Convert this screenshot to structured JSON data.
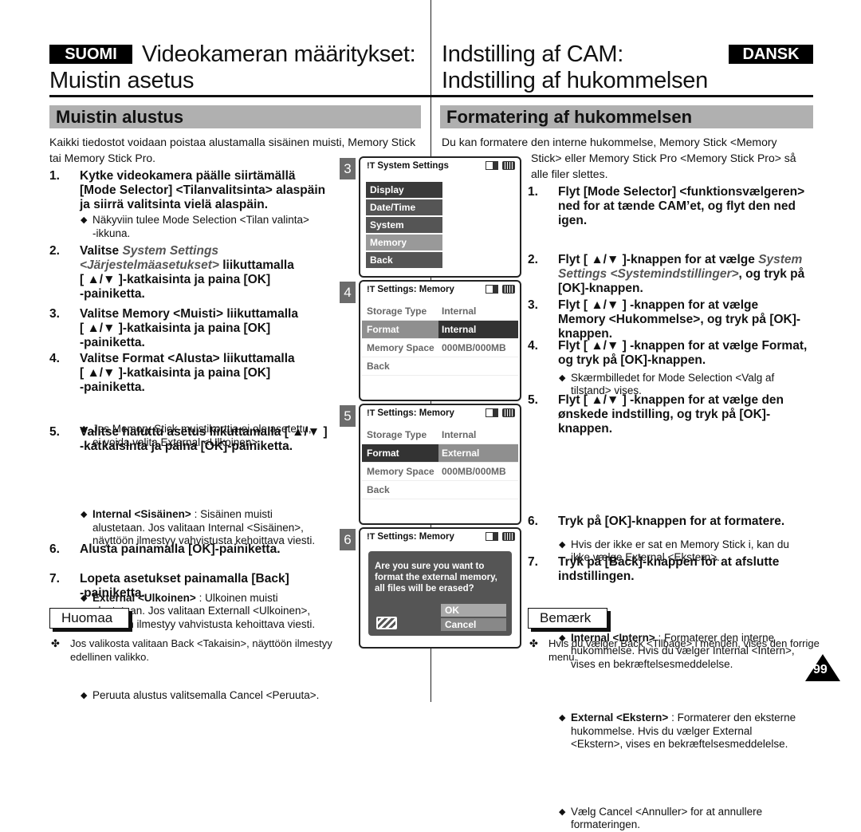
{
  "left": {
    "lang_badge": "SUOMI",
    "title_line1": "Videokameran määritykset:",
    "title_line2": "Muistin asetus",
    "section": "Muistin alustus",
    "intro": "Kaikki tiedostot voidaan poistaa alustamalla sisäinen muisti, Memory Stick tai Memory Stick Pro.",
    "steps": [
      {
        "num": "1.",
        "lines": [
          "Kytke videokamera päälle siirtämällä",
          "[Mode Selector] <Tilanvalitsinta> alaspäin",
          "ja siirrä valitsinta vielä alaspäin."
        ]
      },
      {
        "num": "2.",
        "pre": "Valitse ",
        "italic1": "System Settings",
        "italic2": "<Järjestelmäasetukset>",
        "post": " liikuttamalla",
        "lines": [
          "[ ▲/▼ ]-katkaisinta ja paina [OK]",
          "-painiketta."
        ]
      },
      {
        "num": "3.",
        "lines": [
          "Valitse Memory <Muisti> liikuttamalla",
          "[ ▲/▼ ]-katkaisinta ja paina [OK]",
          "-painiketta."
        ]
      },
      {
        "num": "4.",
        "lines": [
          "Valitse Format <Alusta> liikuttamalla",
          "[ ▲/▼ ]-katkaisinta ja paina [OK]",
          "-painiketta."
        ]
      },
      {
        "num": "5.",
        "lines": [
          "Valitse haluttu asetus liikuttamalla [ ▲/▼ ]",
          "-katkaisinta ja paina [OK]-painiketta."
        ]
      },
      {
        "num": "6.",
        "lines": [
          "Alusta painamalla [OK]-painiketta."
        ]
      },
      {
        "num": "7.",
        "lines": [
          "Lopeta asetukset painamalla [Back]",
          "-painiketta."
        ]
      }
    ],
    "subs": {
      "s1": [
        "Näkyviin tulee Mode Selection <Tilan valinta>",
        "-ikkuna."
      ],
      "s4": [
        "Jos Memory Stick-muistikorttia ei ole asetettu,",
        "ei voida valita External <Ulkoinen>."
      ],
      "s5a_bold": "Internal <Sisäinen>",
      "s5a": [
        " : Sisäinen muisti",
        "alustetaan. Jos valitaan Internal <Sisäinen>,",
        "näyttöön ilmestyy vahvistusta kehoittava viesti."
      ],
      "s5b_bold": "External <Ulkoinen>",
      "s5b": [
        " : Ulkoinen muisti",
        "alustetaan. Jos valitaan Externall <Ulkoinen>,",
        "näyttöön ilmestyy vahvistusta kehoittava viesti."
      ],
      "s6": [
        "Peruuta alustus valitsemalla Cancel <Peruuta>."
      ]
    },
    "note_label": "Huomaa",
    "note_text": [
      "Jos valikosta valitaan Back <Takaisin>, näyttöön ilmestyy",
      "edellinen valikko."
    ]
  },
  "right": {
    "lang_badge": "DANSK",
    "title_line1": "Indstilling af CAM:",
    "title_line2": "Indstilling af hukommelsen",
    "section": "Formatering af hukommelsen",
    "intro_line1": "Du kan formatere den interne hukommelse, Memory Stick <Memory",
    "intro_line2": "Stick> eller Memory Stick Pro <Memory Stick Pro> så",
    "intro_line3": "alle filer slettes.",
    "steps": [
      {
        "num": "1.",
        "lines": [
          "Flyt [Mode Selector] <funktionsvælgeren>",
          "ned for at tænde CAM’et, og flyt den ned",
          "igen."
        ]
      },
      {
        "num": "2.",
        "pre": "Flyt [ ▲/▼ ]-knappen for at vælge ",
        "italic1": "System",
        "italic2": "Settings <Systemindstillinger>",
        "post": ", og tryk på",
        "lines": [
          "[OK]-knappen."
        ]
      },
      {
        "num": "3.",
        "lines": [
          "Flyt [ ▲/▼ ] -knappen for at vælge",
          "Memory <Hukommelse>, og tryk på [OK]-",
          "knappen."
        ]
      },
      {
        "num": "4.",
        "lines": [
          "Flyt [ ▲/▼ ] -knappen for at vælge Format,",
          "og tryk på [OK]-knappen."
        ]
      },
      {
        "num": "5.",
        "lines": [
          "Flyt [ ▲/▼ ] -knappen for at vælge den",
          "ønskede indstilling, og tryk på [OK]-",
          "knappen."
        ]
      },
      {
        "num": "6.",
        "lines": [
          "Tryk på [OK]-knappen for at formatere."
        ]
      },
      {
        "num": "7.",
        "lines": [
          "Tryk på [Back]-knappen for at afslutte",
          "indstillingen."
        ]
      }
    ],
    "subs": {
      "s1": [
        "Skærmbilledet for Mode Selection <Valg af",
        "tilstand> vises."
      ],
      "s4": [
        "Hvis der ikke er sat en Memory Stick i, kan du",
        "ikke vælge External <Ekstern>."
      ],
      "s5a_bold": "Internal <Intern>",
      "s5a": [
        " : Formaterer den interne",
        "hukommelse. Hvis du vælger Internal <Intern>,",
        "vises en bekræftelsesmeddelelse."
      ],
      "s5b_bold": "External <Ekstern>",
      "s5b": [
        " : Formaterer den eksterne",
        "hukommelse. Hvis du vælger External",
        "<Ekstern>, vises en bekræftelsesmeddelelse."
      ],
      "s6": [
        "Vælg Cancel <Annuller> for at annullere",
        "formateringen."
      ]
    },
    "note_label": "Bemærk",
    "note_text": [
      "Hvis du vælger Back <Tilbage> i menuen, vises den forrige",
      "menu."
    ]
  },
  "screens": {
    "s3": {
      "num": "3",
      "title": "System Settings",
      "menu": [
        "Display",
        "Date/Time",
        "System",
        "Memory",
        "Back"
      ],
      "selected": "Memory"
    },
    "s4": {
      "num": "4",
      "title": "Settings: Memory",
      "rows": [
        [
          "Storage Type",
          "Internal"
        ],
        [
          "Format",
          "Internal"
        ],
        [
          "Memory Space",
          "000MB/000MB"
        ],
        [
          "Back",
          ""
        ]
      ]
    },
    "s5": {
      "num": "5",
      "title": "Settings: Memory",
      "rows": [
        [
          "Storage Type",
          "Internal"
        ],
        [
          "Format",
          "External"
        ],
        [
          "Memory Space",
          "000MB/000MB"
        ],
        [
          "Back",
          ""
        ]
      ]
    },
    "s6": {
      "num": "6",
      "title": "Settings: Memory",
      "dialog": [
        "Are you sure you want to",
        "format the external memory,",
        "all files will be erased?"
      ],
      "ok": "OK",
      "cancel": "Cancel"
    }
  },
  "page_number": "99",
  "icons": {
    "settings": "settings-icon",
    "card": "memory-card-icon",
    "battery": "battery-icon",
    "diamond": "◆",
    "clover": "✤"
  }
}
